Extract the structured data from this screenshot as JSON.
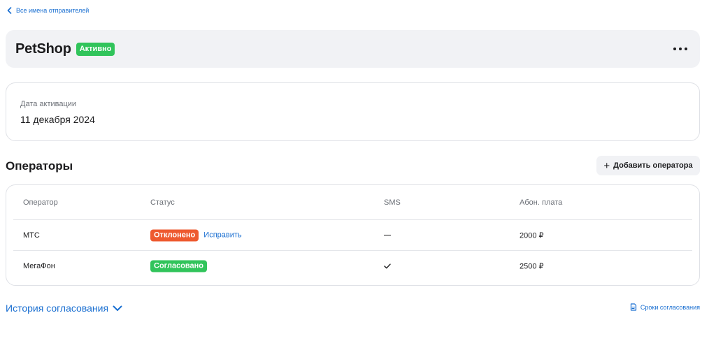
{
  "nav": {
    "back_label": "Все имена отправителей"
  },
  "header": {
    "title": "PetShop",
    "status": "Активно",
    "more_label": "•••"
  },
  "info": {
    "activation_label": "Дата активации",
    "activation_date": "11 декабря 2024"
  },
  "operators": {
    "title": "Операторы",
    "add_button": "Добавить оператора",
    "columns": [
      "Оператор",
      "Статус",
      "SMS",
      "Абон. плата"
    ],
    "rows": [
      {
        "operator": "МТС",
        "status": "Отклонено",
        "status_color": "#ee5a2f",
        "action": "Исправить",
        "sms": "—",
        "sms_icon": "dash-icon",
        "fee": "2000 ₽"
      },
      {
        "operator": "МегаФон",
        "status": "Согласовано",
        "status_color": "#31c45b",
        "sms": "✓",
        "sms_icon": "check-icon",
        "fee": "2500 ₽"
      }
    ]
  },
  "footer": {
    "history_label": "История согласования",
    "terms_label": "Сроки согласования"
  },
  "colors": {
    "accent": "#1a6fd1",
    "success": "#31c45b",
    "danger": "#ee5a2f",
    "panel": "#f1f2f5"
  }
}
